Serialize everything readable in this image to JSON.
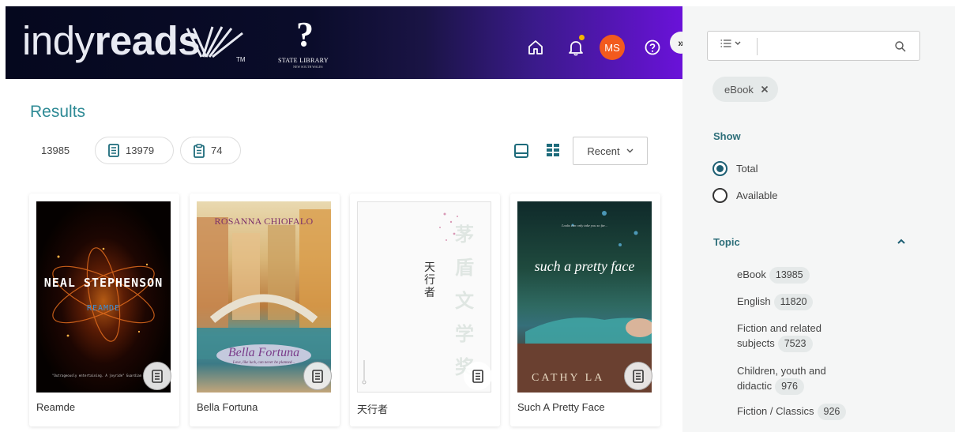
{
  "header": {
    "logo": {
      "word_light": "indy",
      "word_bold": "reads",
      "tm": "TM"
    },
    "library": {
      "name": "STATE LIBRARY",
      "sub": "NEW SOUTH WALES"
    },
    "avatar_initials": "MS",
    "collapse_label": "»",
    "icons": [
      "home-icon",
      "bell-icon",
      "help-icon"
    ],
    "colors": {
      "bg_start": "#05081e",
      "bg_end": "#6a12d9",
      "avatar": "#f25a1d",
      "notification": "#f4b400"
    }
  },
  "results": {
    "title": "Results",
    "total": "13985",
    "ebook_count": "13979",
    "audio_count": "74",
    "sort": {
      "selected": "Recent"
    },
    "accent": "#2e8a95"
  },
  "books": [
    {
      "title": "Reamde",
      "cover": {
        "author": "NEAL STEPHENSON",
        "name": "REAMDE",
        "quote": "\"Outrageously entertaining. A joyride\" Guardian"
      }
    },
    {
      "title": "Bella Fortuna",
      "cover": {
        "author": "ROSANNA CHIOFALO",
        "name": "Bella Fortuna",
        "tagline": "Love, like luck, can never be planned..."
      }
    },
    {
      "title": "天行者",
      "cover": {
        "name": "天行者",
        "series": "茅盾文学奖"
      }
    },
    {
      "title": "Such A Pretty Face",
      "cover": {
        "name": "such a pretty face",
        "author": "CATHY LA",
        "tagline": "Looks can only take you so far..."
      }
    }
  ],
  "sidebar": {
    "search": {
      "type_label": "☰",
      "placeholder": ""
    },
    "active_filter": "eBook",
    "show": {
      "title": "Show",
      "options": [
        {
          "label": "Total",
          "selected": true
        },
        {
          "label": "Available",
          "selected": false
        }
      ]
    },
    "topic": {
      "title": "Topic",
      "items": [
        {
          "label": "eBook",
          "count": "13985"
        },
        {
          "label": "English",
          "count": "11820"
        },
        {
          "label": "Fiction and related subjects",
          "count": "7523"
        },
        {
          "label": "Children, youth and didactic",
          "count": "976"
        },
        {
          "label": "Fiction / Classics",
          "count": "926"
        }
      ]
    }
  }
}
